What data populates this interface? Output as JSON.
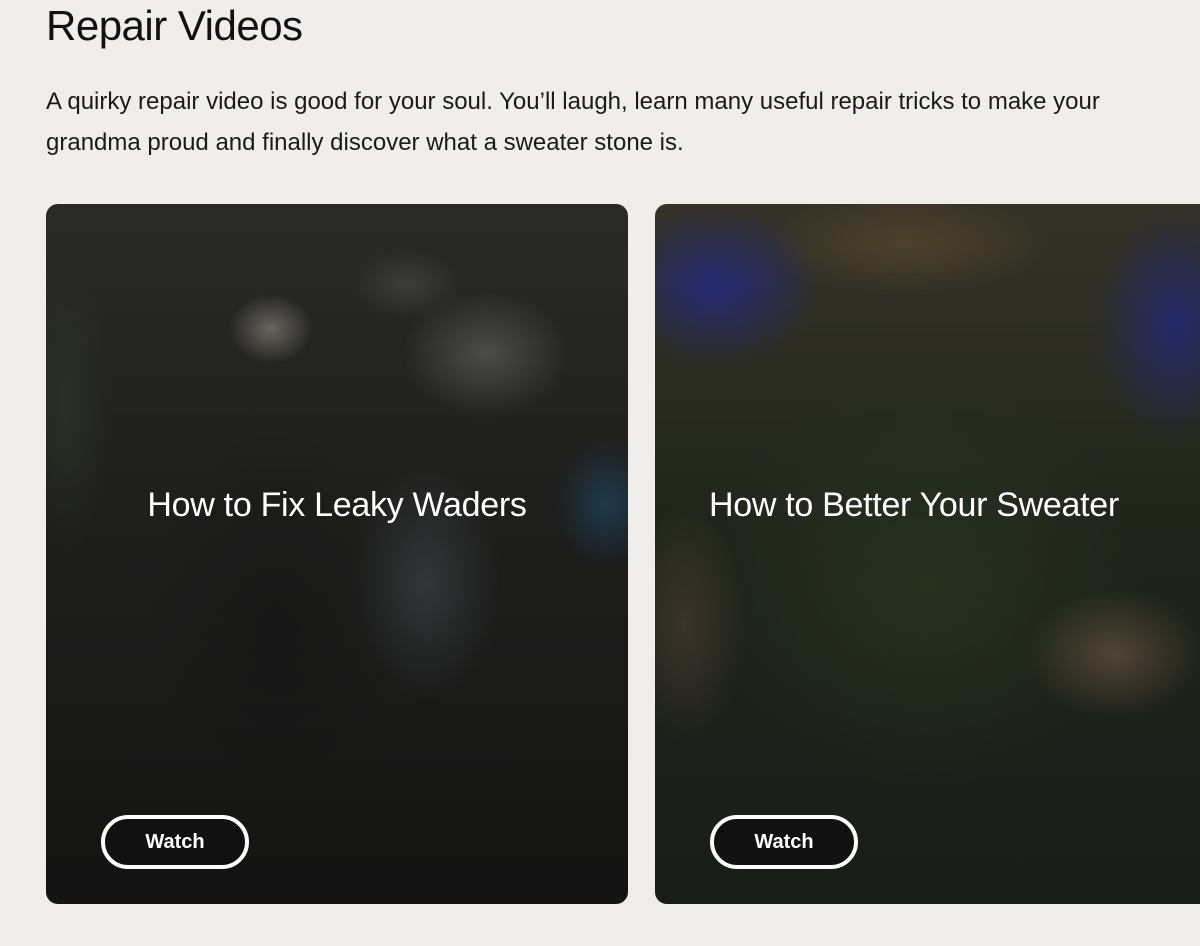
{
  "section": {
    "title": "Repair Videos",
    "description": "A quirky repair video is good for your soul. You’ll laugh, learn many useful repair tricks to make your grandma proud and finally discover what a sweater stone is."
  },
  "cards": [
    {
      "title": "How to Fix Leaky Waders",
      "button_label": "Watch"
    },
    {
      "title": "How to Better Your Sweater",
      "button_label": "Watch"
    }
  ],
  "colors": {
    "page_background": "#efeeea",
    "button_background": "#111111",
    "button_border": "#ffffff",
    "card_text": "#ffffff"
  }
}
